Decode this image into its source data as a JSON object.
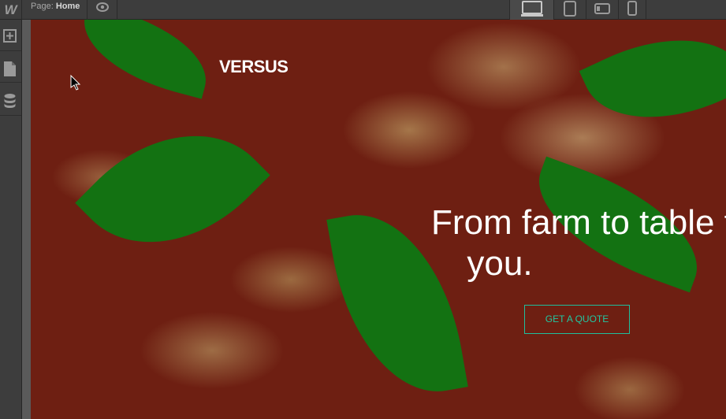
{
  "app": {
    "logo": "W"
  },
  "topbar": {
    "page_label": "Page:",
    "page_name": "Home",
    "preview_icon": "eye-icon",
    "devices": [
      {
        "name": "desktop",
        "icon": "desktop-icon",
        "active": true
      },
      {
        "name": "tablet",
        "icon": "tablet-icon",
        "active": false
      },
      {
        "name": "tablet-landscape",
        "icon": "tablet-landscape-icon",
        "active": false
      },
      {
        "name": "phone",
        "icon": "phone-icon",
        "active": false
      }
    ]
  },
  "lefttoolbar": {
    "items": [
      {
        "name": "add",
        "icon": "plus-icon"
      },
      {
        "name": "pages",
        "icon": "page-icon"
      },
      {
        "name": "cms",
        "icon": "database-icon"
      }
    ]
  },
  "site": {
    "brand": "VERSUS",
    "hero_title_line1": "From farm to table t",
    "hero_title_line2": "you.",
    "cta_label": "GET A QUOTE"
  },
  "colors": {
    "accent": "#21c7a1",
    "toolbar": "#3d3d3d",
    "hero_overlay": "#6e1f12"
  }
}
